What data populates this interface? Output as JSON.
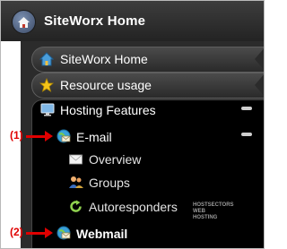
{
  "header": {
    "title": "SiteWorx Home"
  },
  "tabs": [
    {
      "label": "SiteWorx Home",
      "icon": "house-icon"
    },
    {
      "label": "Resource usage",
      "icon": "star-icon"
    }
  ],
  "section": {
    "title": "Hosting Features",
    "icon": "monitor-icon",
    "items": [
      {
        "label": "E-mail",
        "icon": "email-globe-icon",
        "callout": "(1)"
      },
      {
        "label": "Overview",
        "icon": "envelope-icon"
      },
      {
        "label": "Groups",
        "icon": "users-icon"
      },
      {
        "label": "Autoresponders",
        "icon": "refresh-icon"
      },
      {
        "label": "Webmail",
        "icon": "webmail-globe-icon",
        "callout": "(2)"
      }
    ]
  },
  "watermark": {
    "line1": "HOSTSECTORS",
    "line2": "WEB HOSTING"
  },
  "colors": {
    "callout": "#e00000",
    "background": "#000000"
  }
}
